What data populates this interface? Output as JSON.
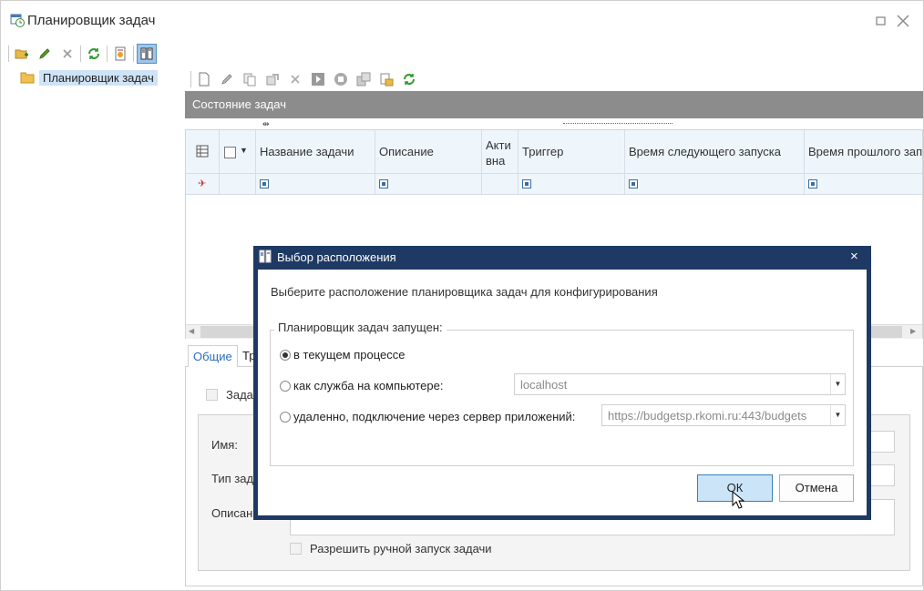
{
  "window": {
    "title": "Планировщик задач",
    "restore_icon": "restore-icon",
    "close_icon": "close-icon"
  },
  "tree": {
    "items": [
      {
        "label": "Планировщик задач",
        "icon": "folder-icon"
      }
    ]
  },
  "grid": {
    "title": "Состояние задач",
    "columns": [
      {
        "label": ""
      },
      {
        "label": ""
      },
      {
        "label": "Название задачи"
      },
      {
        "label": "Описание"
      },
      {
        "label": "Акти вна"
      },
      {
        "label": "Триггер"
      },
      {
        "label": "Время следующего запуска"
      },
      {
        "label": "Время прошлого зап"
      }
    ]
  },
  "tabs": [
    {
      "label": "Общие"
    },
    {
      "label": "Тр"
    }
  ],
  "panel": {
    "checkbox_label": "Задач",
    "name_label": "Имя:",
    "type_label": "Тип зад",
    "desc_label": "Описан",
    "manual_run_label": "Разрешить ручной запуск задачи"
  },
  "dialog": {
    "title": "Выбор расположения",
    "prompt": "Выберите расположение планировщика задач для конфигурирования",
    "group_label": "Планировщик задач запущен:",
    "options": [
      {
        "label": "в текущем процессе",
        "checked": true
      },
      {
        "label": "как служба на компьютере:",
        "value": "localhost"
      },
      {
        "label": "удаленно, подключение через сервер приложений:",
        "value": "https://budgetsp.rkomi.ru:443/budgets"
      }
    ],
    "ok_label": "ОК",
    "cancel_label": "Отмена"
  }
}
